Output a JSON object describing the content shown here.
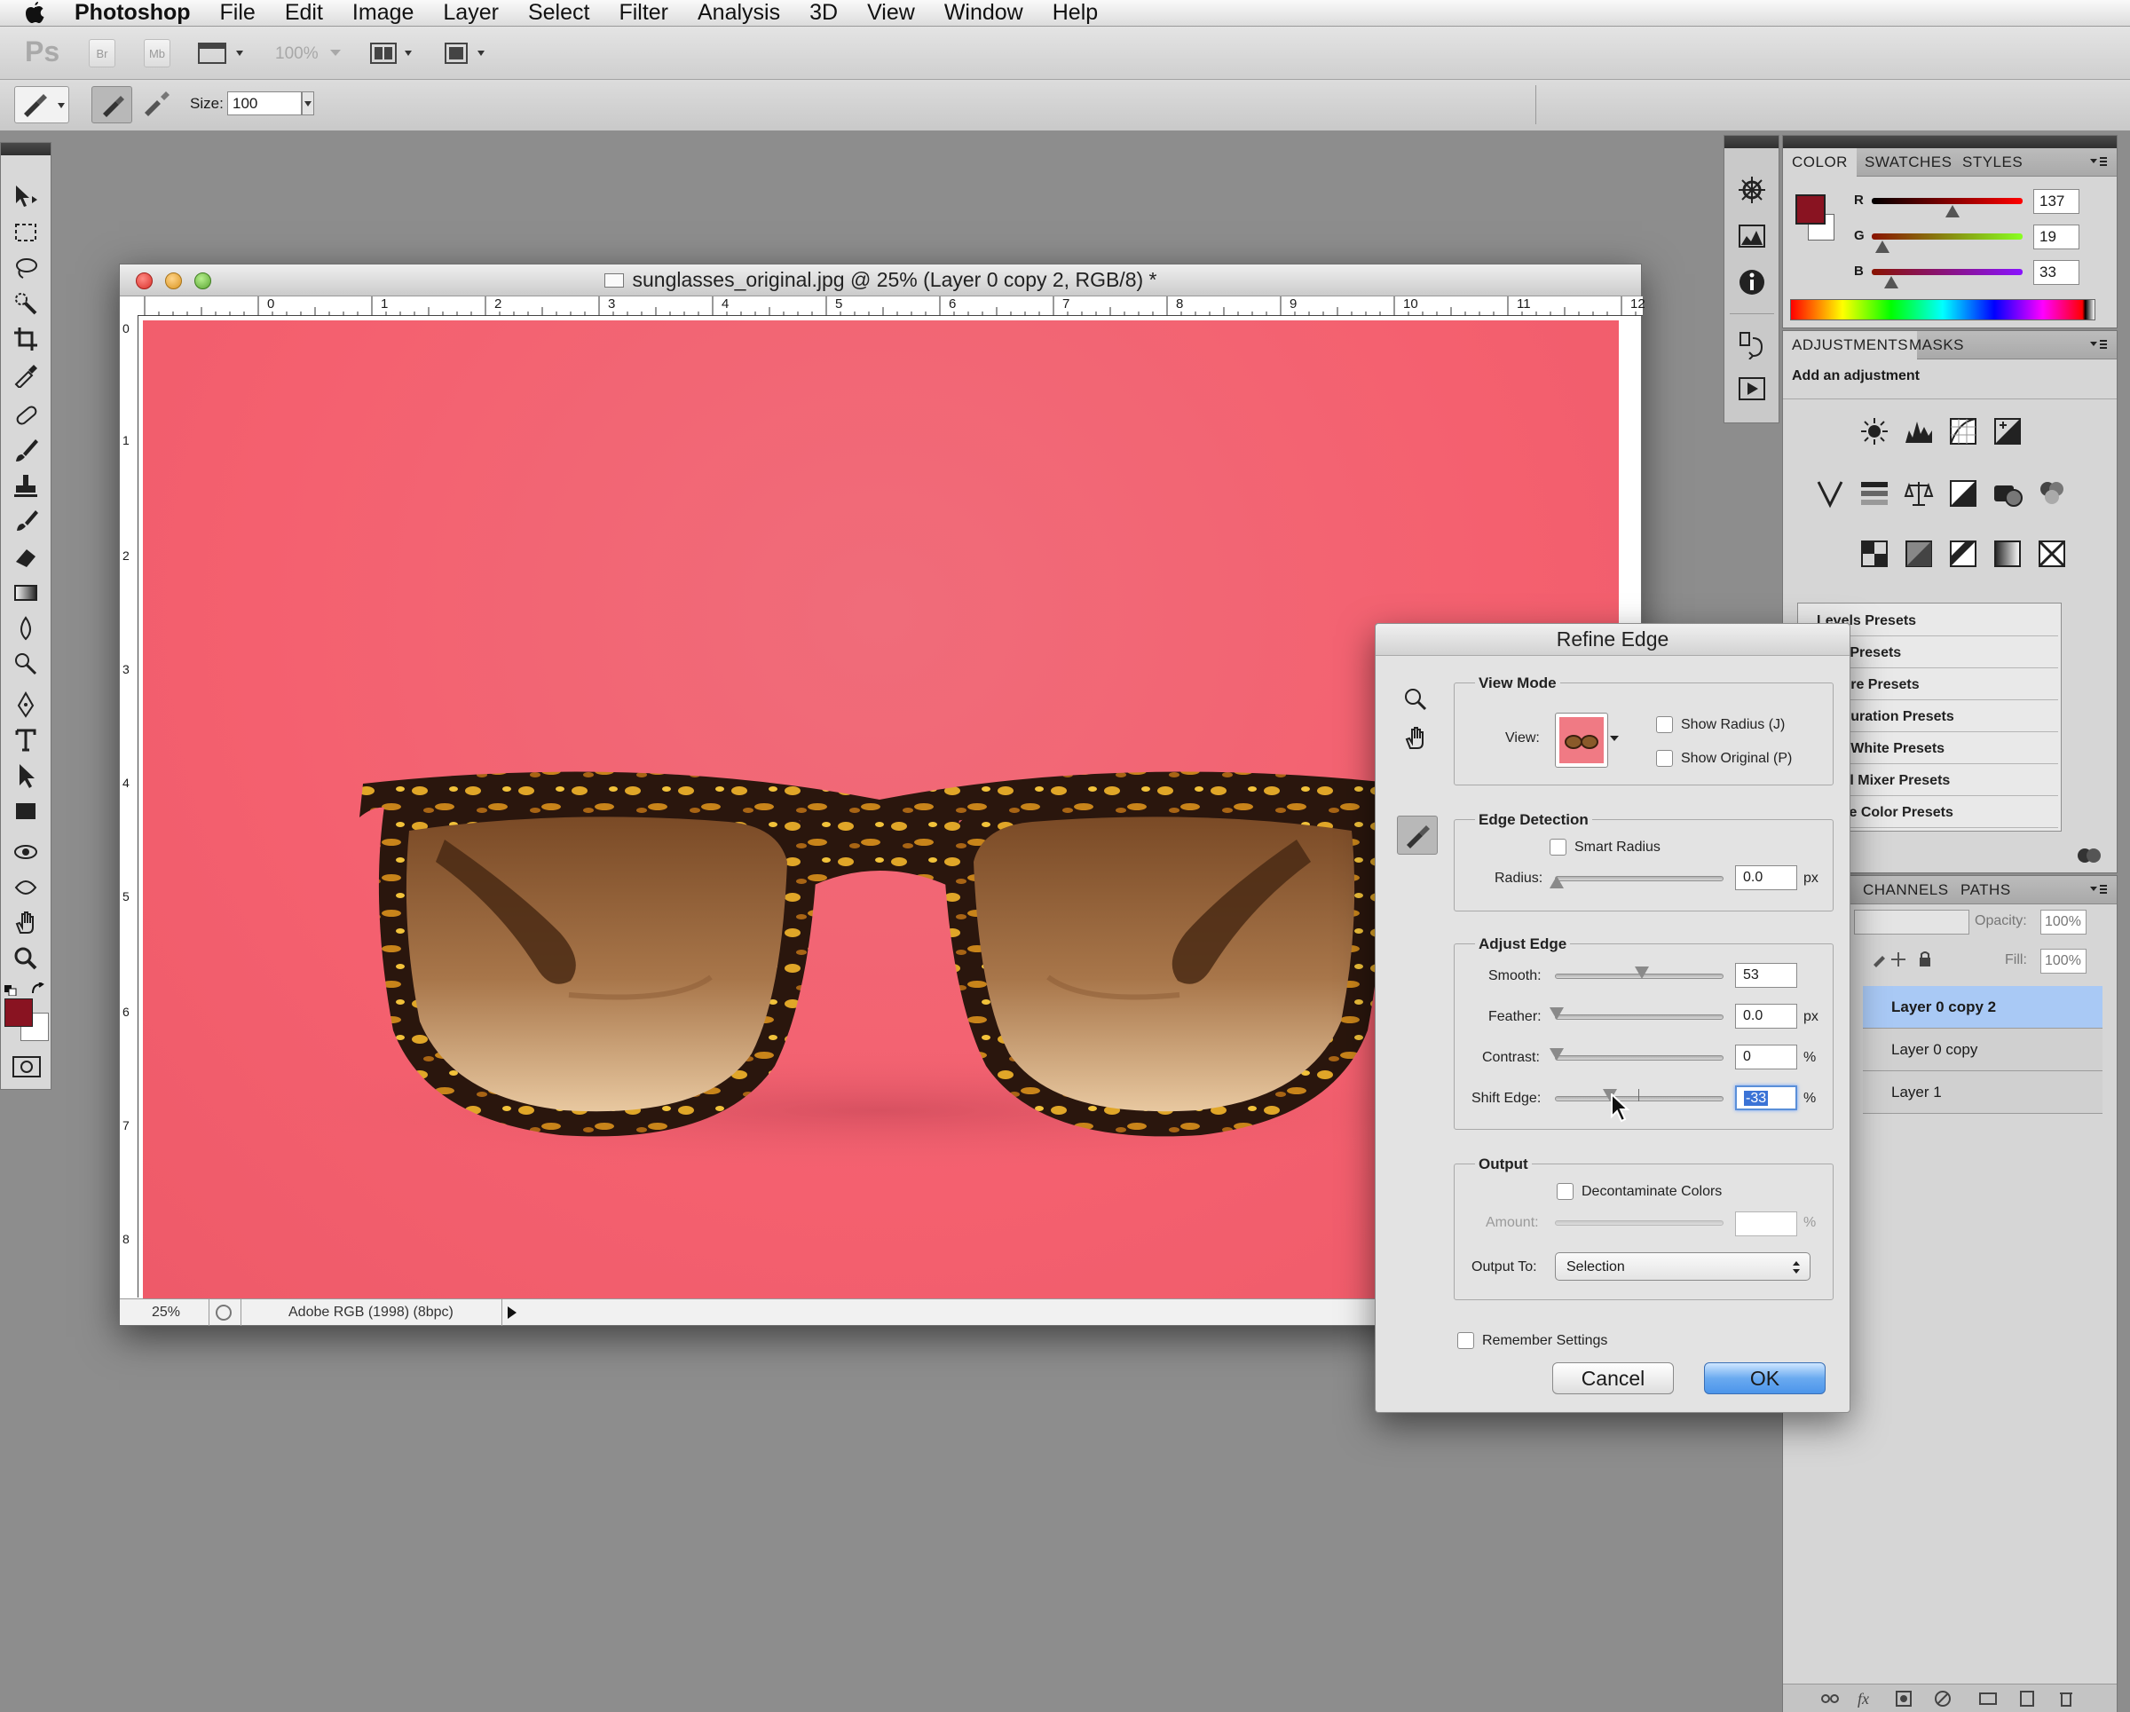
{
  "menubar": {
    "app_name": "Photoshop",
    "items": [
      "File",
      "Edit",
      "Image",
      "Layer",
      "Select",
      "Filter",
      "Analysis",
      "3D",
      "View",
      "Window",
      "Help"
    ]
  },
  "appbar": {
    "ps_logo": "Ps",
    "br": "Br",
    "mb": "Mb",
    "zoom_value": "100%"
  },
  "options": {
    "size_label": "Size:",
    "size_value": "100"
  },
  "document": {
    "title": "sunglasses_original.jpg @ 25% (Layer 0 copy 2, RGB/8) *",
    "zoom": "25%",
    "color_profile": "Adobe RGB (1998) (8bpc)",
    "ruler_h": [
      "0",
      "1",
      "2",
      "3",
      "4",
      "5",
      "6",
      "7",
      "8",
      "9",
      "10",
      "11",
      "12"
    ],
    "ruler_v": [
      "0",
      "1",
      "2",
      "3",
      "4",
      "5",
      "6",
      "7",
      "8"
    ]
  },
  "color_panel": {
    "tabs": [
      "COLOR",
      "SWATCHES",
      "STYLES"
    ],
    "r_label": "R",
    "r_value": "137",
    "g_label": "G",
    "g_value": "19",
    "b_label": "B",
    "b_value": "33",
    "foreground": "#891321"
  },
  "adjustments_panel": {
    "tabs": [
      "ADJUSTMENTS",
      "MASKS"
    ],
    "heading": "Add an adjustment",
    "presets": [
      "Levels Presets",
      "rves Presets",
      "posure Presets",
      "e/Saturation Presets",
      "ck & White Presets",
      "annel Mixer Presets",
      "ective Color Presets"
    ]
  },
  "layers_panel": {
    "tabs": [
      "CHANNELS",
      "PATHS"
    ],
    "opacity_label": "Opacity:",
    "opacity_value": "100%",
    "fill_label": "Fill:",
    "fill_value": "100%",
    "layers": [
      "Layer 0 copy 2",
      "Layer 0 copy",
      "Layer 1"
    ]
  },
  "refine_edge": {
    "title": "Refine Edge",
    "view_mode": {
      "group_label": "View Mode",
      "view_label": "View:",
      "show_radius": "Show Radius (J)",
      "show_original": "Show Original (P)"
    },
    "edge_detection": {
      "group_label": "Edge Detection",
      "smart_radius": "Smart Radius",
      "radius_label": "Radius:",
      "radius_value": "0.0",
      "radius_unit": "px"
    },
    "adjust_edge": {
      "group_label": "Adjust Edge",
      "smooth_label": "Smooth:",
      "smooth_value": "53",
      "feather_label": "Feather:",
      "feather_value": "0.0",
      "feather_unit": "px",
      "contrast_label": "Contrast:",
      "contrast_value": "0",
      "contrast_unit": "%",
      "shift_label": "Shift Edge:",
      "shift_value": "-33",
      "shift_unit": "%"
    },
    "output": {
      "group_label": "Output",
      "decontaminate": "Decontaminate Colors",
      "amount_label": "Amount:",
      "amount_unit": "%",
      "output_to_label": "Output To:",
      "output_to_value": "Selection"
    },
    "remember": "Remember Settings",
    "cancel": "Cancel",
    "ok": "OK"
  }
}
